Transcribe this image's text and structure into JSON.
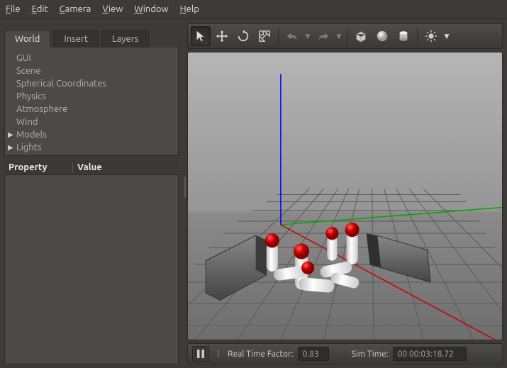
{
  "menu": {
    "file": "File",
    "edit": "Edit",
    "camera": "Camera",
    "view": "View",
    "window": "Window",
    "help": "Help"
  },
  "sidebar": {
    "tabs": {
      "world": "World",
      "insert": "Insert",
      "layers": "Layers"
    },
    "tree": {
      "gui": "GUI",
      "scene": "Scene",
      "spherical": "Spherical Coordinates",
      "physics": "Physics",
      "atmosphere": "Atmosphere",
      "wind": "Wind",
      "models": "Models",
      "lights": "Lights"
    },
    "prop_header": {
      "property": "Property",
      "value": "Value"
    }
  },
  "toolbar": {
    "select": "select",
    "translate": "translate",
    "rotate": "rotate",
    "scale": "scale",
    "undo": "undo",
    "redo": "redo",
    "box": "box",
    "sphere": "sphere",
    "cylinder": "cylinder",
    "light": "light"
  },
  "status": {
    "rtf_label": "Real Time Factor:",
    "rtf_value": "0.83",
    "sim_label": "Sim Time:",
    "sim_value": "00 00:03:18.72"
  },
  "chart_data": {
    "type": "3d-scene",
    "description": "Gazebo simulation viewport with gray ground-plane grid, blue Z-axis, green Y-axis, red X-axis. Two concrete jersey barriers flank a row of white cylindrical pins with red spherical tops; several pins are standing, several knocked over.",
    "axes": {
      "x_color": "#cc0000",
      "y_color": "#00aa00",
      "z_color": "#0000ff"
    },
    "objects": [
      {
        "type": "jersey-barrier",
        "position": "left"
      },
      {
        "type": "jersey-barrier",
        "position": "right"
      },
      {
        "type": "pin",
        "state": "standing",
        "count": 4
      },
      {
        "type": "pin",
        "state": "fallen",
        "count": 4
      }
    ]
  }
}
